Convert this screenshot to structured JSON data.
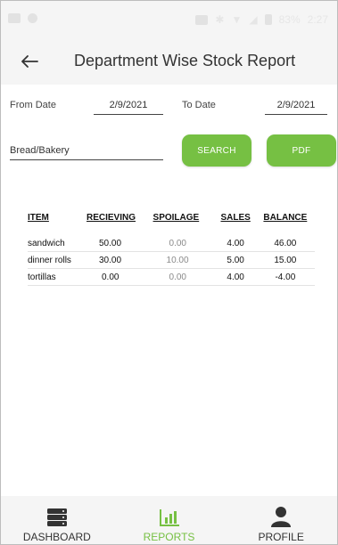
{
  "status_bar": {
    "battery": "83%",
    "time": "2:27"
  },
  "header": {
    "title": "Department Wise Stock Report"
  },
  "filters": {
    "from_label": "From Date",
    "from_value": "2/9/2021",
    "to_label": "To Date",
    "to_value": "2/9/2021",
    "department": "Bread/Bakery",
    "search_label": "SEARCH",
    "pdf_label": "PDF"
  },
  "table": {
    "columns": [
      "ITEM",
      "RECIEVING",
      "SPOILAGE",
      "SALES",
      "BALANCE"
    ],
    "rows": [
      [
        "sandwich",
        "50.00",
        "0.00",
        "4.00",
        "46.00"
      ],
      [
        "dinner rolls",
        "30.00",
        "10.00",
        "5.00",
        "15.00"
      ],
      [
        "tortillas",
        "0.00",
        "0.00",
        "4.00",
        "-4.00"
      ]
    ]
  },
  "nav": {
    "items": [
      {
        "label": "DASHBOARD",
        "icon": "dashboard-icon"
      },
      {
        "label": "REPORTS",
        "icon": "reports-icon",
        "active": true
      },
      {
        "label": "PROFILE",
        "icon": "profile-icon"
      }
    ]
  },
  "colors": {
    "accent": "#76c043",
    "bar_bg": "#f5f5f5",
    "text": "#333333"
  }
}
